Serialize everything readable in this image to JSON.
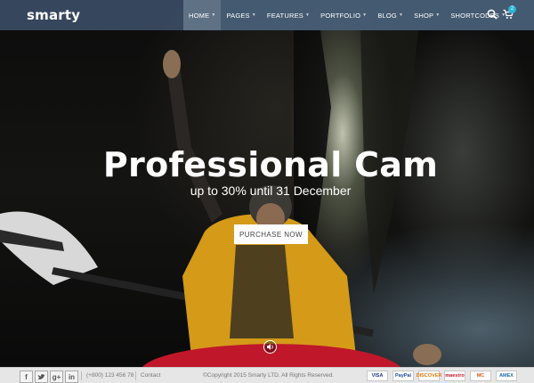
{
  "header": {
    "logo": "smarty",
    "nav": [
      {
        "label": "HOME",
        "active": true
      },
      {
        "label": "PAGES"
      },
      {
        "label": "FEATURES"
      },
      {
        "label": "PORTFOLIO"
      },
      {
        "label": "BLOG"
      },
      {
        "label": "SHOP"
      },
      {
        "label": "SHORTCODES"
      }
    ],
    "cart_count": "2"
  },
  "hero": {
    "title": "Professional Cam",
    "subtitle": "up to 30% until 31 December",
    "button": "PURCHASE NOW"
  },
  "footer": {
    "phone": "(+800) 123 456 78",
    "contact": "Contact",
    "copyright": "©Copyright 2015 Smarty LTD. All Rights Reserved.",
    "payments": [
      "VISA",
      "PayPal",
      "DISCOVER",
      "maestro",
      "MC",
      "AMEX"
    ]
  },
  "colors": {
    "header": "#3c5069",
    "accent": "#2bb5d8",
    "footer": "#e6e6e6"
  }
}
